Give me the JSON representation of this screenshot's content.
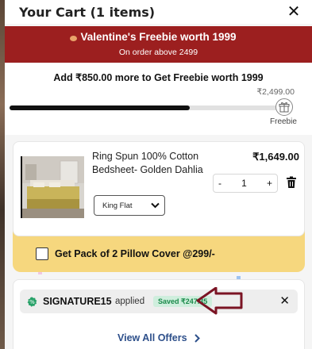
{
  "header": {
    "title": "Your Cart (1 items)",
    "close_icon": "close-icon"
  },
  "banner": {
    "title": "Valentine's Freebie worth 1999",
    "subtitle": "On order above 2499"
  },
  "freebie_progress": {
    "message": "Add ₹850.00 more to Get Freebie worth 1999",
    "goal_amount": "₹2,499.00",
    "goal_label": "Freebie",
    "progress_fraction": 0.66
  },
  "cart_item": {
    "name": "Ring Spun 100% Cotton Bedsheet- Golden Dahlia",
    "price": "₹1,649.00",
    "variant": "King Flat",
    "quantity": "1",
    "minus": "-",
    "plus": "+"
  },
  "addon": {
    "label": "Get Pack of 2 Pillow Cover @299/-"
  },
  "coupon": {
    "code": "SIGNATURE15",
    "status": "applied",
    "saved": "Saved ₹247.35",
    "remove": "✕"
  },
  "offers": {
    "link": "View All Offers"
  },
  "colors": {
    "banner": "#9c1f1f",
    "addon_bg": "#f6d77e",
    "offers_link": "#2d4f8a",
    "saved_badge": "#1a8a4a",
    "annotation_arrow": "#7b1424"
  }
}
